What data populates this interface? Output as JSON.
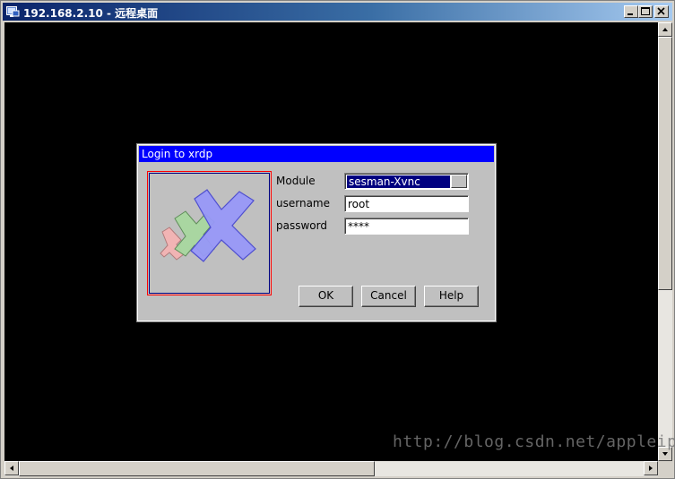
{
  "window": {
    "title": "192.168.2.10 - 远程桌面"
  },
  "dialog": {
    "title": "Login to xrdp",
    "module_label": "Module",
    "module_value": "sesman-Xvnc",
    "username_label": "username",
    "username_value": "root",
    "password_label": "password",
    "password_value": "****",
    "ok_label": "OK",
    "cancel_label": "Cancel",
    "help_label": "Help"
  },
  "logo": {
    "colors": {
      "pink": "#f4b4b4",
      "green": "#a8d8a0",
      "blue": "#9898f8"
    }
  },
  "watermark": "http://blog.csdn.net/appleipp",
  "colors": {
    "titlebar_start": "#0a246a",
    "dialog_title": "#0000ff",
    "combo_selected": "#000080",
    "desktop": "#000000"
  }
}
